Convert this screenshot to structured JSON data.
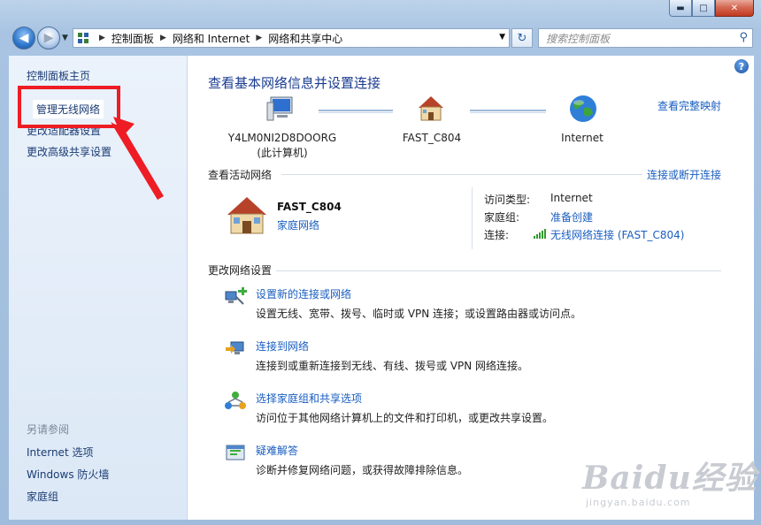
{
  "window": {
    "min_label": "▬",
    "max_label": "□",
    "close_label": "✕"
  },
  "nav": {
    "back_icon": "◀",
    "forward_icon": "▶",
    "breadcrumbs": [
      "控制面板",
      "网络和 Internet",
      "网络和共享中心"
    ],
    "search_placeholder": "搜索控制面板"
  },
  "sidebar": {
    "items": [
      "控制面板主页",
      "管理无线网络",
      "更改适配器设置",
      "更改高级共享设置"
    ],
    "see_also_title": "另请参阅",
    "see_also_items": [
      "Internet 选项",
      "Windows 防火墙",
      "家庭组"
    ]
  },
  "main": {
    "help_label": "?",
    "title": "查看基本网络信息并设置连接",
    "full_map_link": "查看完整映射",
    "nodes": [
      {
        "line1": "Y4LM0NI2D8DOORG",
        "line2": "(此计算机)"
      },
      {
        "line1": "FAST_C804",
        "line2": ""
      },
      {
        "line1": "Internet",
        "line2": ""
      }
    ],
    "active_section_title": "查看活动网络",
    "connect_disconnect_link": "连接或断开连接",
    "active_network": {
      "name": "FAST_C804",
      "type": "家庭网络",
      "access_type_label": "访问类型:",
      "access_type_value": "Internet",
      "homegroup_label": "家庭组:",
      "homegroup_value": "准备创建",
      "connection_label": "连接:",
      "connection_value": "无线网络连接 (FAST_C804)"
    },
    "change_section_title": "更改网络设置",
    "tasks": [
      {
        "title": "设置新的连接或网络",
        "desc": "设置无线、宽带、拨号、临时或 VPN 连接；或设置路由器或访问点。"
      },
      {
        "title": "连接到网络",
        "desc": "连接到或重新连接到无线、有线、拨号或 VPN 网络连接。"
      },
      {
        "title": "选择家庭组和共享选项",
        "desc": "访问位于其他网络计算机上的文件和打印机，或更改共享设置。"
      },
      {
        "title": "疑难解答",
        "desc": "诊断并修复网络问题，或获得故障排除信息。"
      }
    ]
  },
  "watermark": {
    "big": "Baidu经验",
    "small": "jingyan.baidu.com"
  },
  "colors": {
    "highlight": "#ee1c24",
    "link": "#1a5ec0",
    "title": "#1a3b8f"
  }
}
